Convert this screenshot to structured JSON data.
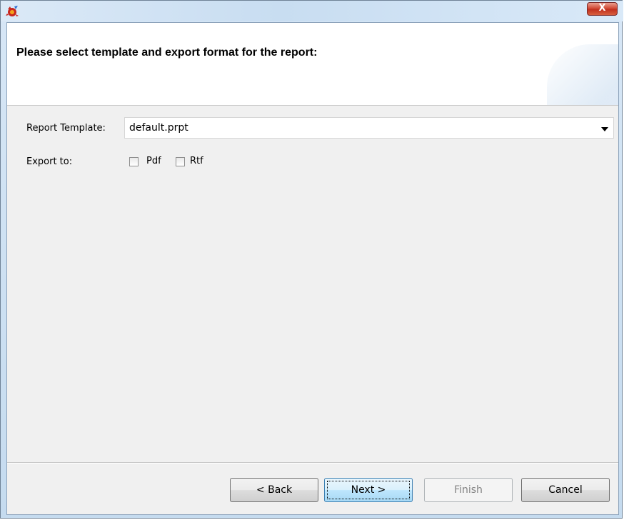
{
  "window": {
    "close_label": "X"
  },
  "header": {
    "title": "Please select template and export format for the report:"
  },
  "form": {
    "template_label": "Report Template:",
    "template_value": "default.prpt",
    "export_label": "Export to:",
    "pdf_label": "Pdf",
    "rtf_label": "Rtf",
    "pdf_checked": false,
    "rtf_checked": false
  },
  "buttons": {
    "back": "< Back",
    "next": "Next >",
    "finish": "Finish",
    "cancel": "Cancel"
  },
  "colors": {
    "accent": "#3c7fb1"
  }
}
